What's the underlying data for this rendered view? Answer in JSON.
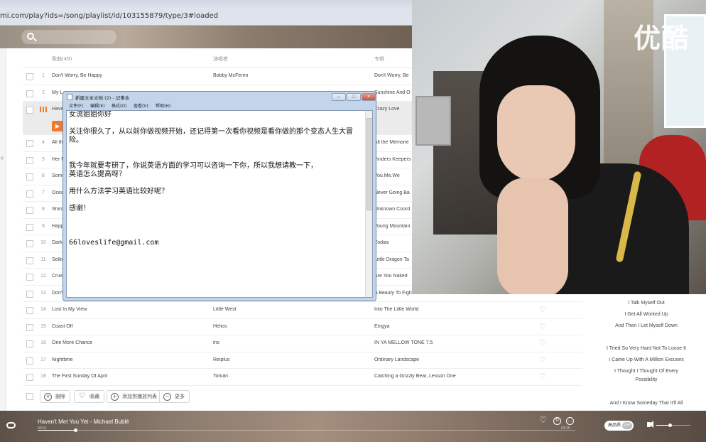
{
  "browser": {
    "address": "mi.com/play?ids=/song/playlist/id/103155879/type/3#loaded"
  },
  "table": {
    "headers": {
      "title": "歌曲(49)",
      "artist": "演唱者",
      "album": "专辑"
    },
    "rows": [
      {
        "num": "1",
        "title": "Don't Worry, Be Happy",
        "artist": "Bobby McFerrin",
        "album": "Don't Worry, Be"
      },
      {
        "num": "2",
        "title": "My L",
        "artist": "",
        "album": "Sunshine And O"
      },
      {
        "num": "",
        "title": "Have",
        "artist": "",
        "album": "Crazy Love",
        "playing": true
      },
      {
        "num": "4",
        "title": "All th",
        "artist": "",
        "album": "All the Memorie"
      },
      {
        "num": "5",
        "title": "Her M",
        "artist": "",
        "album": "Finders Keepers"
      },
      {
        "num": "6",
        "title": "Some",
        "artist": "",
        "album": "You.Me.We"
      },
      {
        "num": "7",
        "title": "Ocea",
        "artist": "",
        "album": "Never Going Ba"
      },
      {
        "num": "8",
        "title": "Shiro",
        "artist": "",
        "album": "Unknown Coord"
      },
      {
        "num": "9",
        "title": "Happ",
        "artist": "",
        "album": "Young Mountain"
      },
      {
        "num": "10",
        "title": "Dark",
        "artist": "",
        "album": "Zodiac"
      },
      {
        "num": "11",
        "title": "Sellin",
        "artist": "",
        "album": "Little Dragon Ta"
      },
      {
        "num": "12",
        "title": "Cruis",
        "artist": "",
        "album": "Are You Naked"
      },
      {
        "num": "13",
        "title": "Don't",
        "artist": "",
        "album": "A Beauty To Figh"
      },
      {
        "num": "14",
        "title": "Lost In My View",
        "artist": "Little West",
        "album": "Into The Little World"
      },
      {
        "num": "15",
        "title": "Coast Off",
        "artist": "Helios",
        "album": "Eingya"
      },
      {
        "num": "16",
        "title": "One More Chance",
        "artist": "iris",
        "album": "IN YA MELLOW TONE 7.5"
      },
      {
        "num": "17",
        "title": "Nighttime",
        "artist": "Reiplus",
        "album": "Ordinary Landscape"
      },
      {
        "num": "18",
        "title": "The First Sunday Of April",
        "artist": "Tomán",
        "album": "Catching a Grizzly Bear, Lesson One"
      }
    ]
  },
  "actions": {
    "delete": "删除",
    "favorite": "收藏",
    "add_to_list": "添加到播放列表",
    "more": "更多"
  },
  "player": {
    "now_playing": "Haven't Met You Yet - Michael Bublé",
    "time_elapsed": "00:01",
    "time_total": "03:25",
    "progress": 0.07,
    "volume": 0.4,
    "hq_label": "高品质",
    "hq_state": "OFF"
  },
  "lyrics": [
    "I Talk Myself Out",
    "I Get All Worked Up",
    "And Then I Let Myself Down",
    "",
    "I Tried So Very Hard Not To Loose It",
    "I Came Up With A Million Excuses",
    "I Thought I Thought Of Every Possibility",
    "",
    "And I Know Someday That It'll All"
  ],
  "notepad": {
    "title": "新建文本文档 (2) - 记事本",
    "menu": [
      "文件(F)",
      "编辑(E)",
      "格式(O)",
      "查看(V)",
      "帮助(H)"
    ],
    "lines": [
      "女流姐姐你好",
      "",
      "关注你很久了，从以前你做视频开始，还记得第一次看你视频是看你做的那个变态人生大冒险。",
      "",
      "",
      "我今年就要考研了，你说英语方面的学习可以咨询一下你，所以我想请教一下，",
      "英语怎么提高呀？",
      "",
      "用什么方法学习英语比较好呢？",
      "",
      "感谢！",
      "",
      "",
      "",
      "66loveslife@gmail.com"
    ]
  },
  "webcam": {
    "watermark": "优酷"
  }
}
